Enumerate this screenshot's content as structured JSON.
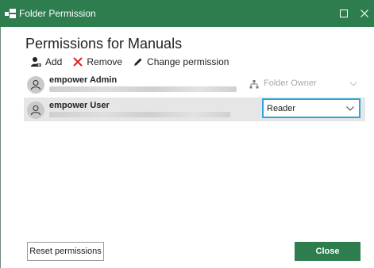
{
  "window": {
    "title": "Folder Permission",
    "accent_color": "#2e7d4f",
    "maximize_icon": "maximize-icon",
    "close_icon": "close-icon"
  },
  "heading": "Permissions for Manuals",
  "toolbar": {
    "add_label": "Add",
    "remove_label": "Remove",
    "change_label": "Change permission"
  },
  "users": [
    {
      "name": "empower Admin",
      "permission": "Folder Owner",
      "permission_editable": false
    },
    {
      "name": "empower User",
      "permission": "Reader",
      "permission_editable": true,
      "selected": true
    }
  ],
  "footer": {
    "reset_label": "Reset permissions",
    "close_label": "Close"
  }
}
